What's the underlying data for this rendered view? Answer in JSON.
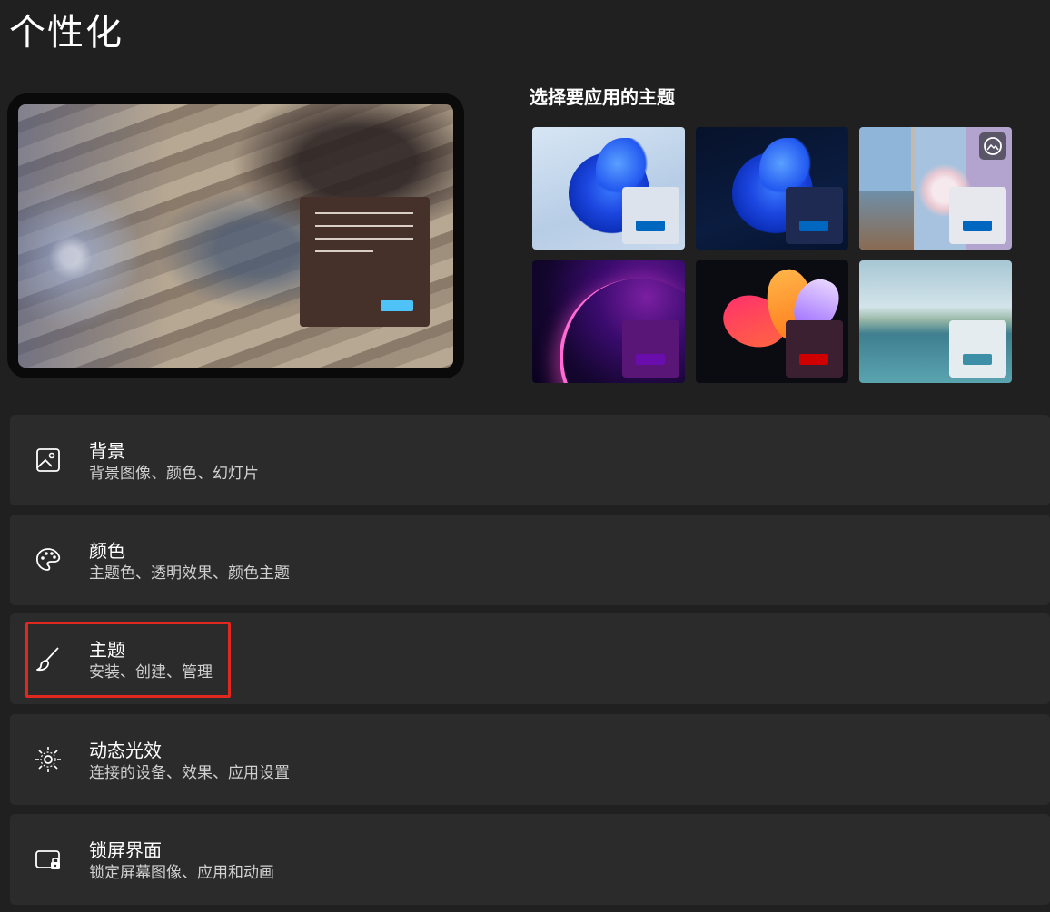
{
  "page": {
    "title": "个性化"
  },
  "themes": {
    "heading": "选择要应用的主题",
    "items": [
      {
        "name": "windows-light",
        "accent": "#0067c0"
      },
      {
        "name": "windows-dark",
        "accent": "#0067c0"
      },
      {
        "name": "windows-spotlight",
        "accent": "#0067c0",
        "icon": "slideshow-icon"
      },
      {
        "name": "glow",
        "accent": "#6a0dad"
      },
      {
        "name": "captured-motion",
        "accent": "#d10000"
      },
      {
        "name": "flow",
        "accent": "#3d8fa8"
      }
    ]
  },
  "settings": [
    {
      "icon": "image-icon",
      "title": "背景",
      "desc": "背景图像、颜色、幻灯片"
    },
    {
      "icon": "palette-icon",
      "title": "颜色",
      "desc": "主题色、透明效果、颜色主题"
    },
    {
      "icon": "brush-icon",
      "title": "主题",
      "desc": "安装、创建、管理"
    },
    {
      "icon": "dynamic-lighting-icon",
      "title": "动态光效",
      "desc": "连接的设备、效果、应用设置"
    },
    {
      "icon": "lock-screen-icon",
      "title": "锁屏界面",
      "desc": "锁定屏幕图像、应用和动画"
    }
  ],
  "colors": {
    "background": "#202020",
    "card": "#2b2b2b",
    "highlight": "#e0281e",
    "preview_button": "#4fc3f7"
  }
}
